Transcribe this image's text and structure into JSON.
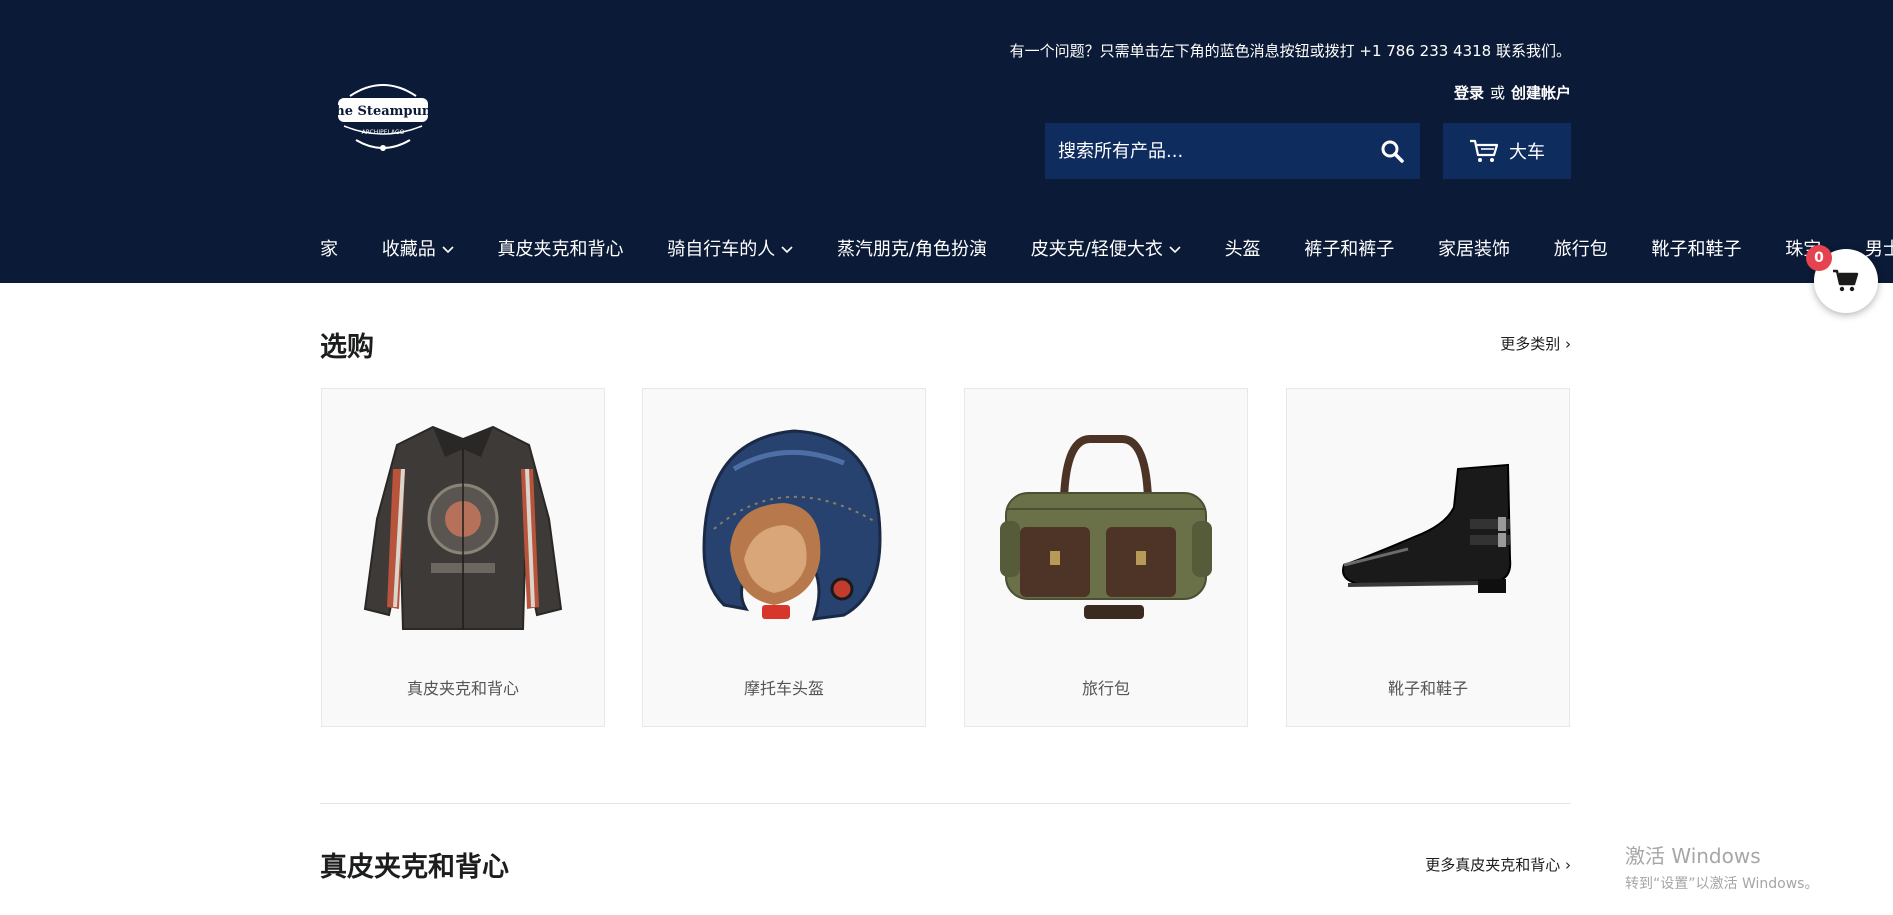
{
  "header": {
    "notice": "有一个问题？只需单击左下角的蓝色消息按钮或拨打 +1 786 233 4318 联系我们。",
    "login": "登录",
    "or": "或",
    "create_account": "创建帐户",
    "logo_text": "The Steampunk Archipelago",
    "search_placeholder": "搜索所有产品...",
    "cart_label": "大车"
  },
  "nav": {
    "items": [
      "家",
      "收藏品",
      "真皮夹克和背心",
      "骑自行车的人",
      "蒸汽朋克/角色扮演",
      "皮夹克/轻便大衣",
      "头盔",
      "裤子和裤子",
      "家居装饰",
      "旅行包",
      "靴子和鞋子",
      "珠宝",
      "男士仔"
    ]
  },
  "shop": {
    "title": "选购",
    "more": "更多类别 ›",
    "cards": [
      {
        "label": "真皮夹克和背心",
        "icon": "leather-jacket-icon"
      },
      {
        "label": "摩托车头盔",
        "icon": "helmet-icon"
      },
      {
        "label": "旅行包",
        "icon": "duffel-bag-icon"
      },
      {
        "label": "靴子和鞋子",
        "icon": "boot-icon"
      }
    ]
  },
  "section2": {
    "title": "真皮夹克和背心",
    "more": "更多真皮夹克和背心 ›"
  },
  "floating_cart": {
    "count": "0"
  },
  "watermark": {
    "line1": "激活 Windows",
    "line2": "转到“设置”以激活 Windows。"
  },
  "colors": {
    "header_bg": "#0b1a36",
    "button_bg": "#0f2c5e",
    "badge": "#e4434f"
  }
}
